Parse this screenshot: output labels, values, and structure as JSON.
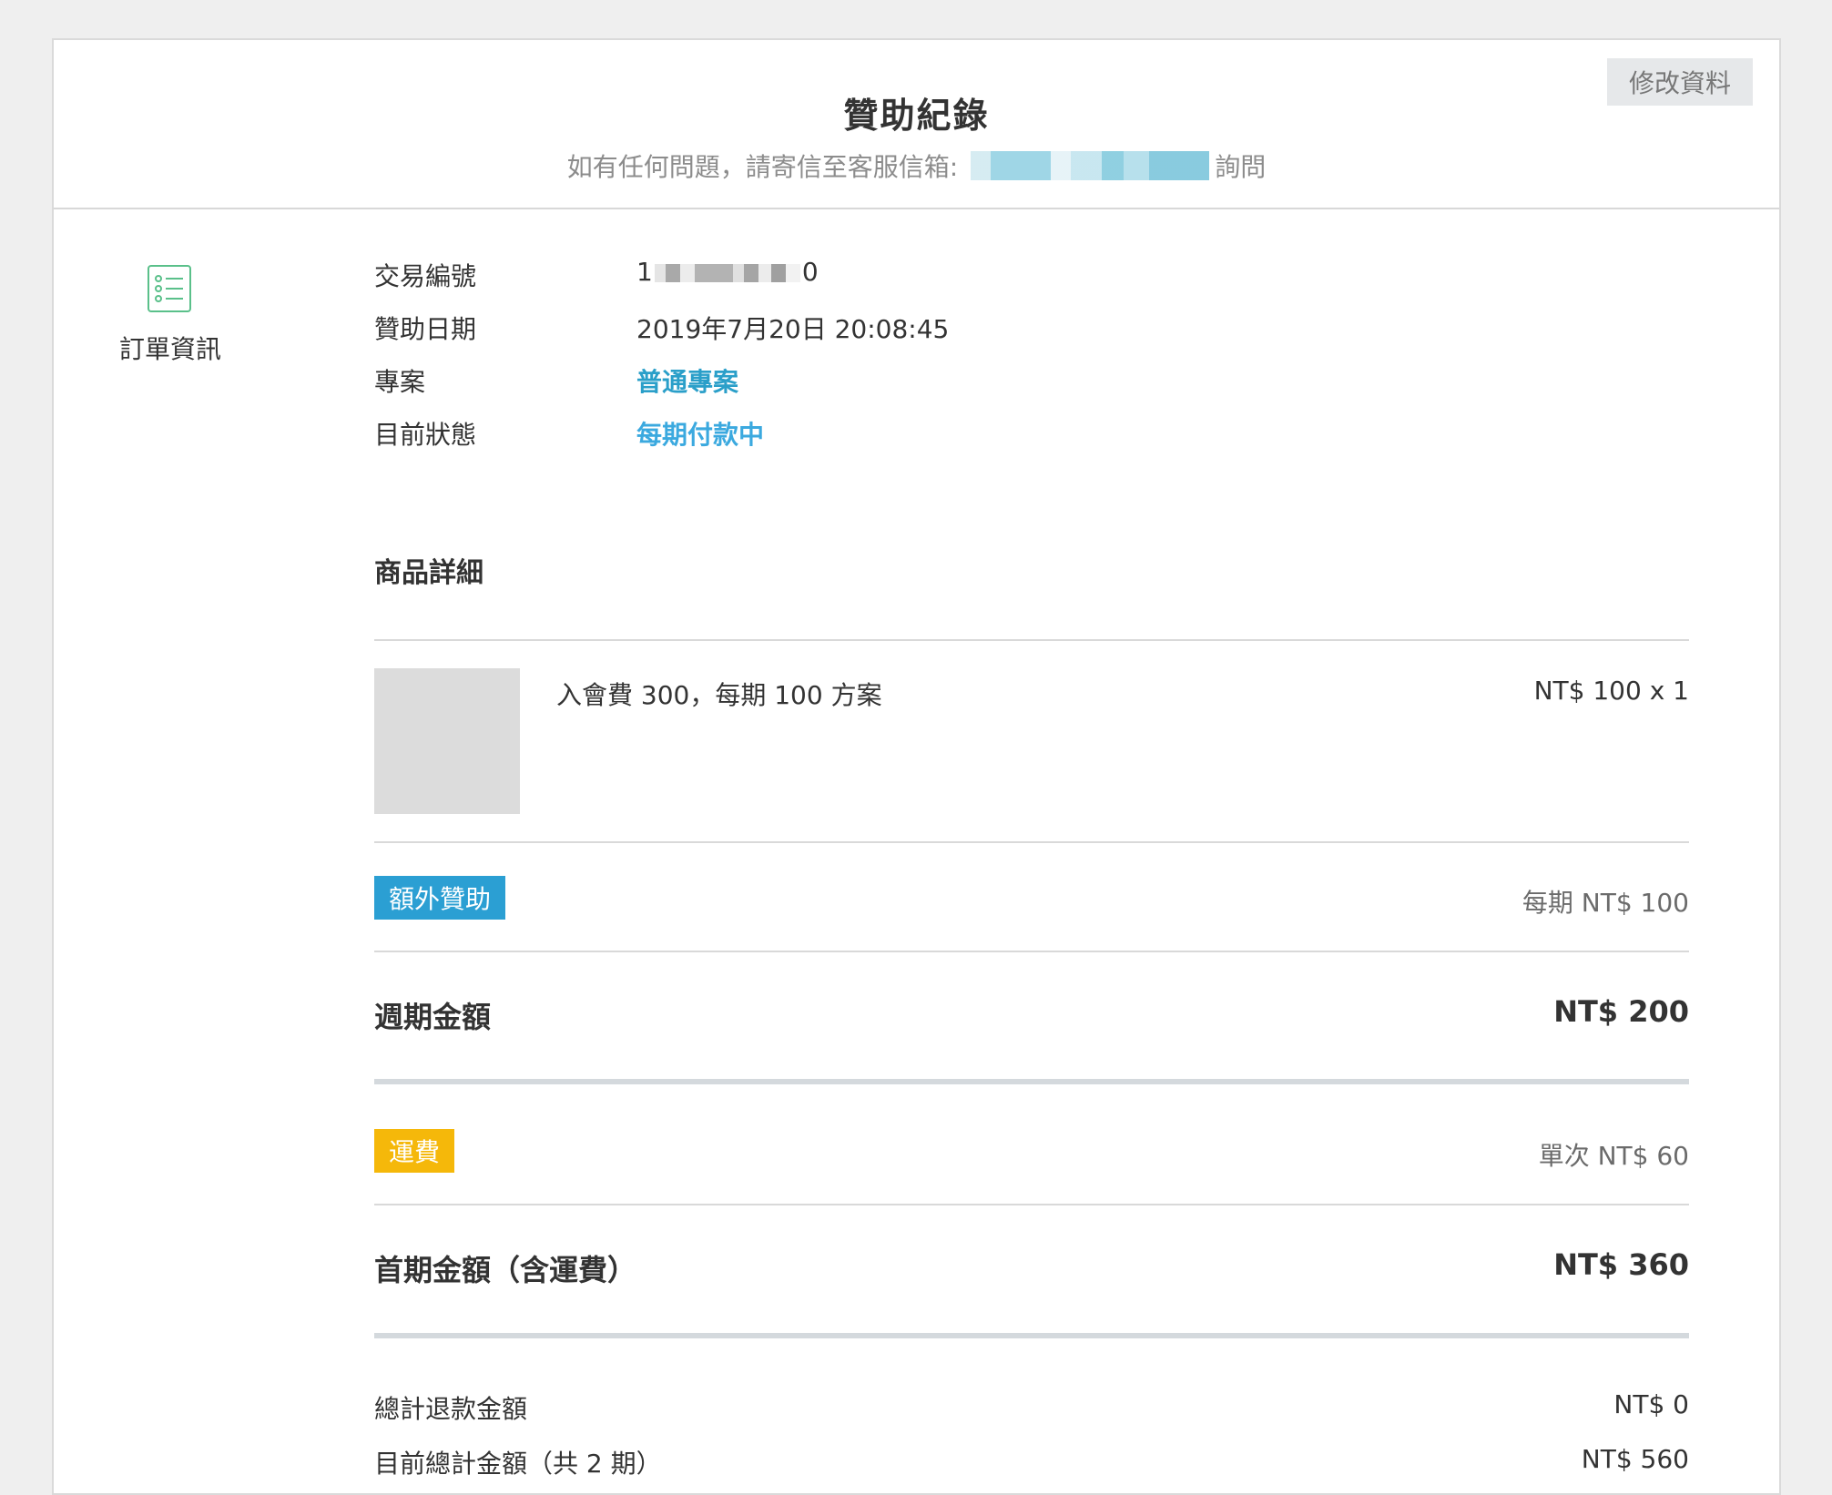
{
  "header": {
    "title": "贊助紀錄",
    "subtitle_prefix": "如有任何問題，請寄信至客服信箱:",
    "subtitle_suffix": "詢問",
    "edit_label": "修改資料"
  },
  "sidebar": {
    "icon": "list-icon",
    "label": "訂單資訊"
  },
  "order_info": {
    "txn_label": "交易編號",
    "txn_value_start": "1",
    "txn_value_end": "0",
    "date_label": "贊助日期",
    "date_value": "2019年7月20日 20:08:45",
    "project_label": "專案",
    "project_value": "普通專案",
    "status_label": "目前狀態",
    "status_value": "每期付款中"
  },
  "product_details": {
    "title": "商品詳細",
    "item_name": "入會費 300，每期 100 方案",
    "item_price": "NT$ 100 x 1"
  },
  "extra": {
    "tag": "額外贊助",
    "value": "每期 NT$ 100"
  },
  "cycle_total": {
    "label": "週期金額",
    "value": "NT$ 200"
  },
  "shipping": {
    "tag": "運費",
    "value": "單次 NT$ 60"
  },
  "first_total": {
    "label": "首期金額（含運費）",
    "value": "NT$ 360"
  },
  "summary": {
    "refund_label": "總計退款金額",
    "refund_value": "NT$ 0",
    "current_label": "目前總計金額（共 2 期）",
    "current_value": "NT$ 560"
  },
  "colors": {
    "link": "#2a9fc9",
    "status": "#3ba9df",
    "tag_blue": "#2b9fd3",
    "tag_yellow": "#f5b80a",
    "icon_green": "#5ac08a"
  }
}
